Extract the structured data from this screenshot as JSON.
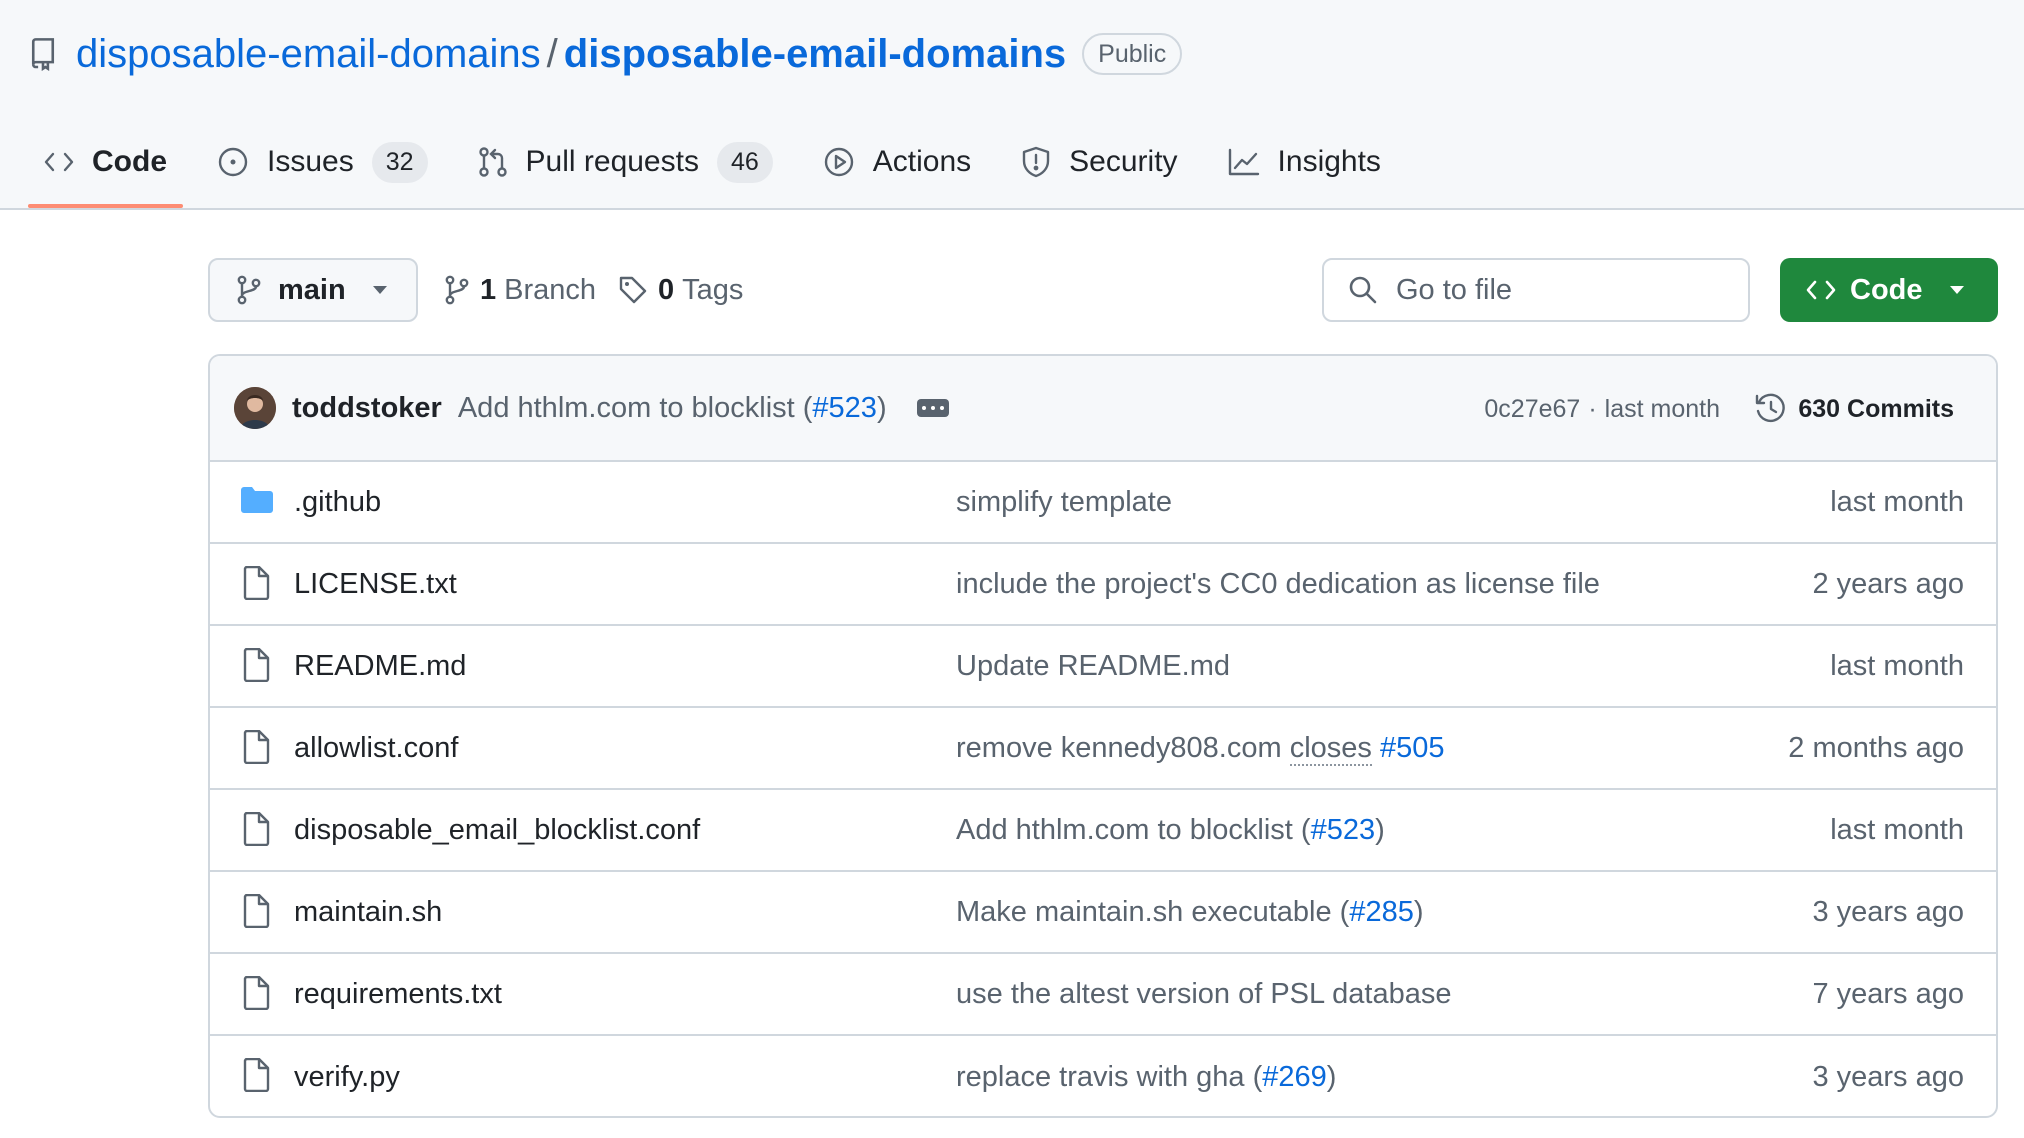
{
  "repo": {
    "owner": "disposable-email-domains",
    "separator": "/",
    "name": "disposable-email-domains",
    "visibility": "Public"
  },
  "tabs": [
    {
      "label": "Code",
      "icon": "code-icon",
      "selected": true
    },
    {
      "label": "Issues",
      "icon": "issue-icon",
      "count": "32"
    },
    {
      "label": "Pull requests",
      "icon": "pull-request-icon",
      "count": "46"
    },
    {
      "label": "Actions",
      "icon": "play-icon"
    },
    {
      "label": "Security",
      "icon": "shield-icon"
    },
    {
      "label": "Insights",
      "icon": "graph-icon"
    }
  ],
  "toolbar": {
    "branch": "main",
    "branch_count": "1",
    "branch_label": "Branch",
    "tag_count": "0",
    "tag_label": "Tags",
    "search_placeholder": "Go to file",
    "code_button": "Code"
  },
  "latest_commit": {
    "author": "toddstoker",
    "message": "Add hthlm.com to blocklist (",
    "pr": "#523",
    "message_end": ")",
    "sha": "0c27e67",
    "meta_sep": "·",
    "time": "last month",
    "commits": "630 Commits"
  },
  "files": [
    {
      "name": ".github",
      "type": "folder",
      "msg": "simplify template",
      "date": "last month"
    },
    {
      "name": "LICENSE.txt",
      "type": "file",
      "msg": "include the project's CC0 dedication as license file",
      "date": "2 years ago"
    },
    {
      "name": "README.md",
      "type": "file",
      "msg": "Update README.md",
      "date": "last month"
    },
    {
      "name": "allowlist.conf",
      "type": "file",
      "msg": "remove kennedy808.com",
      "msg_dotted": "closes",
      "pr": "#505",
      "date": "2 months ago"
    },
    {
      "name": "disposable_email_blocklist.conf",
      "type": "file",
      "msg": "Add hthlm.com to blocklist (",
      "pr": "#523",
      "msg_end": ")",
      "date": "last month"
    },
    {
      "name": "maintain.sh",
      "type": "file",
      "msg": "Make maintain.sh executable (",
      "pr": "#285",
      "msg_end": ")",
      "date": "3 years ago"
    },
    {
      "name": "requirements.txt",
      "type": "file",
      "msg": "use the altest version of PSL database",
      "date": "7 years ago"
    },
    {
      "name": "verify.py",
      "type": "file",
      "msg": "replace travis with gha (",
      "pr": "#269",
      "msg_end": ")",
      "date": "3 years ago"
    }
  ],
  "colors": {
    "link": "#0969da",
    "muted": "#59636e",
    "border": "#d0d7de",
    "header_bg": "#f6f8fa",
    "code_button": "#1f883d",
    "tab_underline": "#fd8c73",
    "folder": "#54aeff"
  }
}
